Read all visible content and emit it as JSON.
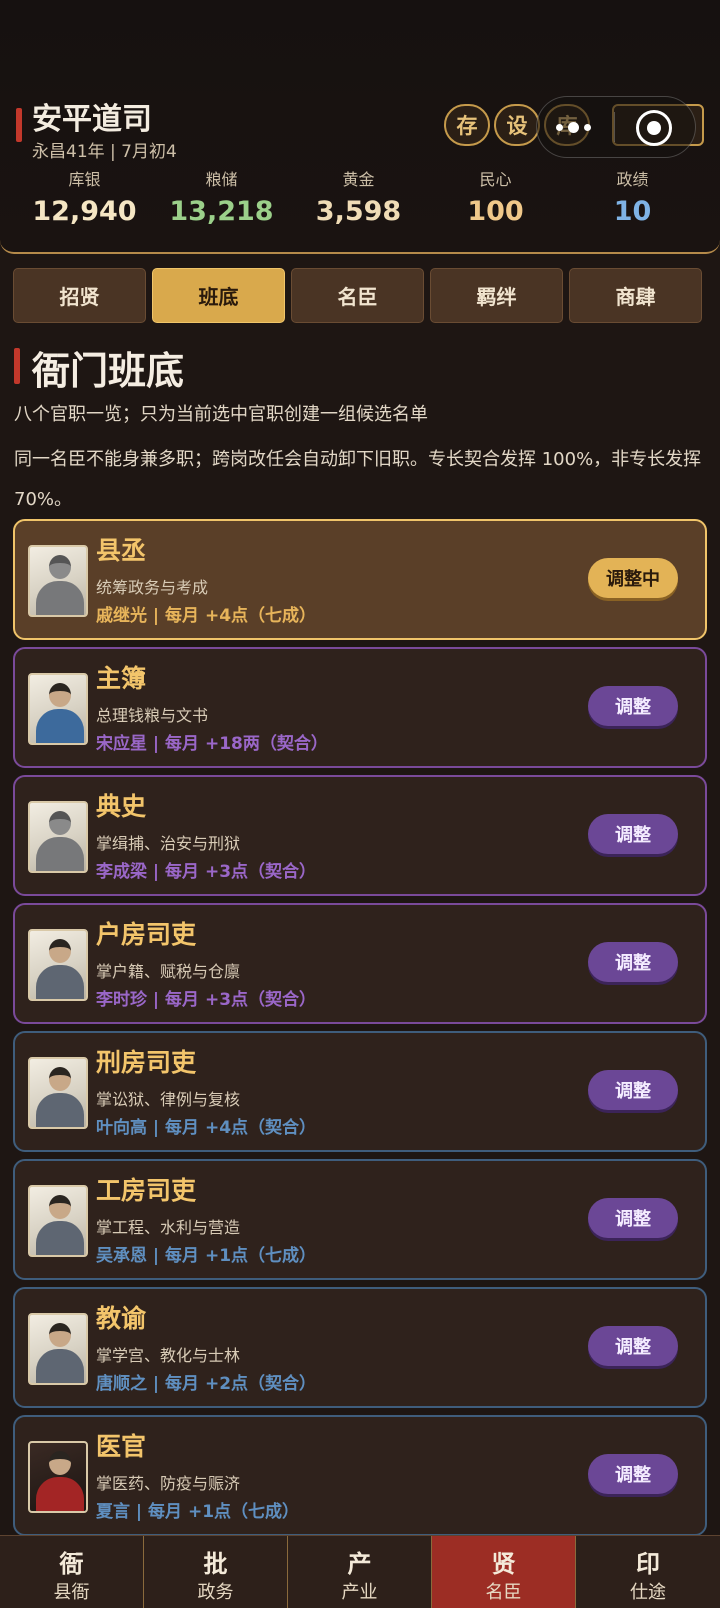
{
  "header": {
    "title": "安平道司",
    "date": "永昌41年 | 7月初4",
    "buttons": [
      "存",
      "设",
      "库"
    ],
    "stats": [
      {
        "label": "库银",
        "value": "12,940",
        "color": "#f5e6c4"
      },
      {
        "label": "粮储",
        "value": "13,218",
        "color": "#9bd08a"
      },
      {
        "label": "黄金",
        "value": "3,598",
        "color": "#f0dcb6"
      },
      {
        "label": "民心",
        "value": "100",
        "color": "#f0c88a"
      },
      {
        "label": "政绩",
        "value": "10",
        "color": "#7fb3e6"
      }
    ]
  },
  "tabs": [
    "招贤",
    "班底",
    "名臣",
    "羁绊",
    "商肆"
  ],
  "active_tab": "班底",
  "section": {
    "title": "衙门班底",
    "desc1": "八个官职一览；只为当前选中官职创建一组候选名单",
    "desc2": "同一名臣不能身兼多职；跨岗改任会自动卸下旧职。专长契合发挥 100%，非专长发挥 70%。"
  },
  "offices": [
    {
      "title": "县丞",
      "duty": "统筹政务与考成",
      "assignment": "戚继光 | 每月 +4点（七成）",
      "assign_color": "#e7b45a",
      "button": "调整中",
      "active": true,
      "tone": "active",
      "portrait": "armor"
    },
    {
      "title": "主簿",
      "duty": "总理钱粮与文书",
      "assignment": "宋应星 | 每月 +18两（契合）",
      "assign_color": "#9a67c8",
      "button": "调整",
      "active": false,
      "tone": "purple",
      "portrait": "blue"
    },
    {
      "title": "典史",
      "duty": "掌缉捕、治安与刑狱",
      "assignment": "李成梁 | 每月 +3点（契合）",
      "assign_color": "#9a67c8",
      "button": "调整",
      "active": false,
      "tone": "purple",
      "portrait": "armor"
    },
    {
      "title": "户房司吏",
      "duty": "掌户籍、赋税与仓廪",
      "assignment": "李时珍 | 每月 +3点（契合）",
      "assign_color": "#9a67c8",
      "button": "调整",
      "active": false,
      "tone": "purple",
      "portrait": "gray"
    },
    {
      "title": "刑房司吏",
      "duty": "掌讼狱、律例与复核",
      "assignment": "叶向高 | 每月 +4点（契合）",
      "assign_color": "#5f8fc0",
      "button": "调整",
      "active": false,
      "tone": "blue",
      "portrait": "gray"
    },
    {
      "title": "工房司吏",
      "duty": "掌工程、水利与营造",
      "assignment": "吴承恩 | 每月 +1点（七成）",
      "assign_color": "#5f8fc0",
      "button": "调整",
      "active": false,
      "tone": "blue",
      "portrait": "gray"
    },
    {
      "title": "教谕",
      "duty": "掌学宫、教化与士林",
      "assignment": "唐顺之 | 每月 +2点（契合）",
      "assign_color": "#5f8fc0",
      "button": "调整",
      "active": false,
      "tone": "blue",
      "portrait": "gray"
    },
    {
      "title": "医官",
      "duty": "掌医药、防疫与赈济",
      "assignment": "夏言 | 每月 +1点（七成）",
      "assign_color": "#5f8fc0",
      "button": "调整",
      "active": false,
      "tone": "blue",
      "portrait": "red"
    }
  ],
  "bottom_nav": [
    {
      "icon": "衙",
      "label": "县衙"
    },
    {
      "icon": "批",
      "label": "政务"
    },
    {
      "icon": "产",
      "label": "产业"
    },
    {
      "icon": "贤",
      "label": "名臣"
    },
    {
      "icon": "印",
      "label": "仕途"
    }
  ],
  "active_nav": "名臣"
}
